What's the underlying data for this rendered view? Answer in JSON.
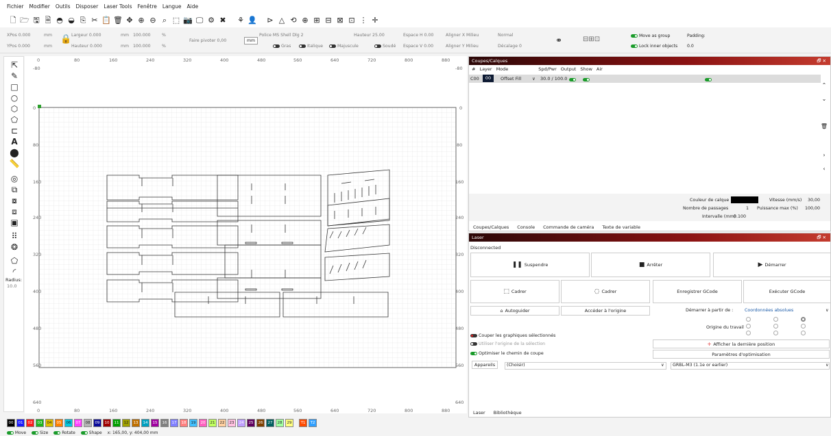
{
  "menu": [
    "Fichier",
    "Modifier",
    "Outils",
    "Disposer",
    "Laser Tools",
    "Fenêtre",
    "Langue",
    "Aide"
  ],
  "props": {
    "xpos_label": "XPos",
    "xpos": "0.000",
    "ypos_label": "YPos",
    "ypos": "0.000",
    "unit_mm": "mm",
    "width_label": "Largeur",
    "width": "0.000",
    "height_label": "Hauteur",
    "height": "0.000",
    "pct1": "100.000",
    "pct2": "100.000",
    "pct": "%",
    "rotate_label": "Faire pivoter",
    "rotate": "0,00",
    "mm_btn": "mm",
    "font_label": "Police",
    "font": "MS Shell Dlg 2",
    "fheight_label": "Hauteur",
    "fheight": "25.00",
    "hspace_label": "Espace H",
    "hspace": "0.00",
    "vspace_label": "Espace V",
    "vspace": "0.00",
    "alignx_label": "Aligner X",
    "alignx": "Milieu",
    "aligny_label": "Aligner Y",
    "aligny": "Milieu",
    "normal": "Normal",
    "offset_label": "Décalage",
    "offset": "0",
    "bold": "Gras",
    "italic": "Italique",
    "upper": "Majuscule",
    "welded": "Soudé",
    "move_group": "Move as group",
    "lock_inner": "Lock inner objects",
    "padding_label": "Padding:",
    "padding": "0.0"
  },
  "left_tools": {
    "radius_label": "Radius:",
    "radius": "10.0"
  },
  "ruler": {
    "top": [
      "0",
      "80",
      "160",
      "240",
      "320",
      "400",
      "480",
      "560",
      "640",
      "720",
      "800",
      "880"
    ],
    "left": [
      "-80",
      "0",
      "80",
      "160",
      "240",
      "320",
      "400",
      "480",
      "560",
      "640"
    ],
    "right": [
      "-80",
      "0",
      "80",
      "160",
      "240",
      "320",
      "400",
      "480",
      "560",
      "640"
    ],
    "bottom": [
      "0",
      "80",
      "160",
      "240",
      "320",
      "400",
      "480",
      "560",
      "640",
      "720",
      "800",
      "880"
    ]
  },
  "cuts": {
    "title": "Coupes/Calques",
    "headers": [
      "#",
      "Layer",
      "Mode",
      "Spd/Pwr",
      "Output",
      "Show",
      "Air"
    ],
    "row": {
      "id": "C00",
      "layer": "00",
      "mode": "Offset Fill",
      "spdpwr": "30.0 / 100.0"
    },
    "layer_color_label": "Couleur de calque",
    "layer_color": "#000000",
    "speed_label": "Vitesse (mm/s)",
    "speed": "30,00",
    "passes_label": "Nombre de passages",
    "passes": "1",
    "maxpower_label": "Puissance max (%)",
    "maxpower": "100,00",
    "interval_label": "Intervalle (mm)",
    "interval": "0.100",
    "tabs": [
      "Coupes/Calques",
      "Console",
      "Commande de caméra",
      "Texte de variable"
    ]
  },
  "laser": {
    "title": "Laser",
    "status": "Disconnected",
    "pause": "Suspendre",
    "stop": "Arrêter",
    "start": "Démarrer",
    "frame1": "Cadrer",
    "frame2": "Cadrer",
    "save_gcode": "Enregistrer GCode",
    "run_gcode": "Exécuter GCode",
    "home": "Autoguider",
    "goto_origin": "Accéder à l'origine",
    "start_from_label": "Démarrer à partir de :",
    "start_from": "Coordonnées absolues",
    "job_origin": "Origine du travail",
    "cut_selected": "Couper les graphiques sélectionnés",
    "use_sel_origin": "Utiliser l'origine de la sélection",
    "optimize": "Optimiser le chemin de coupe",
    "show_last": "Afficher la dernière position",
    "opt_settings": "Paramètres d'optimisation",
    "devices": "Appareils",
    "choose": "(Choisir)",
    "profile": "GRBL-M3 (1.1e or earlier)",
    "tabs": [
      "Laser",
      "Bibliothèque"
    ]
  },
  "palette": [
    {
      "l": "00",
      "c": "#000000"
    },
    {
      "l": "01",
      "c": "#1a1aff"
    },
    {
      "l": "02",
      "c": "#ff1a1a"
    },
    {
      "l": "03",
      "c": "#1fb51f"
    },
    {
      "l": "04",
      "c": "#e0c000"
    },
    {
      "l": "05",
      "c": "#ff8000"
    },
    {
      "l": "06",
      "c": "#00c8e0"
    },
    {
      "l": "07",
      "c": "#ff40ff"
    },
    {
      "l": "08",
      "c": "#b4b4b4"
    },
    {
      "l": "09",
      "c": "#0a0a9a"
    },
    {
      "l": "10",
      "c": "#a00000"
    },
    {
      "l": "11",
      "c": "#00a000"
    },
    {
      "l": "12",
      "c": "#a0a000"
    },
    {
      "l": "13",
      "c": "#c07000"
    },
    {
      "l": "14",
      "c": "#00a0c0"
    },
    {
      "l": "15",
      "c": "#a000a0"
    },
    {
      "l": "16",
      "c": "#808080"
    },
    {
      "l": "17",
      "c": "#8080ff"
    },
    {
      "l": "18",
      "c": "#ff8080"
    },
    {
      "l": "19",
      "c": "#40c0ff"
    },
    {
      "l": "20",
      "c": "#ff60c0"
    },
    {
      "l": "21",
      "c": "#c0ff60"
    },
    {
      "l": "22",
      "c": "#ffd0a0"
    },
    {
      "l": "23",
      "c": "#ffc0e0"
    },
    {
      "l": "24",
      "c": "#c0a0ff"
    },
    {
      "l": "25",
      "c": "#600060"
    },
    {
      "l": "26",
      "c": "#804000"
    },
    {
      "l": "27",
      "c": "#006060"
    },
    {
      "l": "28",
      "c": "#a0ffa0"
    },
    {
      "l": "29",
      "c": "#ffff80"
    },
    {
      "l": "T1",
      "c": "#ff4a00"
    },
    {
      "l": "T2",
      "c": "#30a0ff"
    }
  ],
  "status": {
    "move": "Move",
    "size": "Size",
    "rotate": "Rotate",
    "shape": "Shape",
    "coords": "x: 165,00, y: 404,00 mm"
  }
}
